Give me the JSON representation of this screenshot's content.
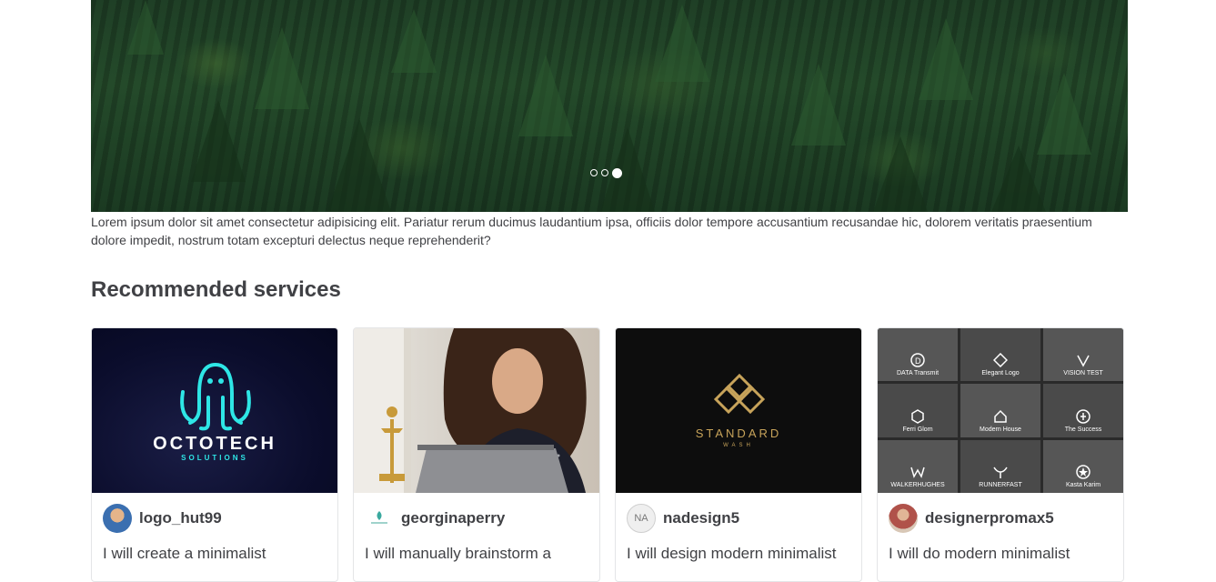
{
  "hero": {
    "slide_count": 3,
    "active_slide": 3,
    "caption": "Lorem ipsum dolor sit amet consectetur adipisicing elit. Pariatur rerum ducimus laudantium ipsa, officiis dolor tempore accusantium recusandae hic, dolorem veritatis praesentium dolore impedit, nostrum totam excepturi delectus neque reprehenderit?"
  },
  "recommended": {
    "title": "Recommended services",
    "cards": [
      {
        "seller": "logo_hut99",
        "description": "I will create a minimalist",
        "thumb_brand": "OCTOTECH",
        "thumb_sub": "SOLUTIONS"
      },
      {
        "seller": "georginaperry",
        "description": "I will manually brainstorm a"
      },
      {
        "seller": "nadesign5",
        "avatar_initials": "NA",
        "description": "I will design modern minimalist",
        "thumb_brand": "STANDARD",
        "thumb_sub": "WASH"
      },
      {
        "seller": "designerpromax5",
        "description": "I will do modern minimalist",
        "thumb_tiles": [
          "DATA Transmit",
          "Elegant Logo",
          "VISION TEST",
          "Ferri Glom",
          "Modern House",
          "The Success",
          "WALKERHUGHES",
          "RUNNERFAST",
          "Kasta Karim"
        ]
      }
    ]
  },
  "colors": {
    "text_dark": "#404145",
    "border": "#e4e5e7",
    "octo_accent": "#2ee6e6",
    "gold": "#c7a35a"
  }
}
